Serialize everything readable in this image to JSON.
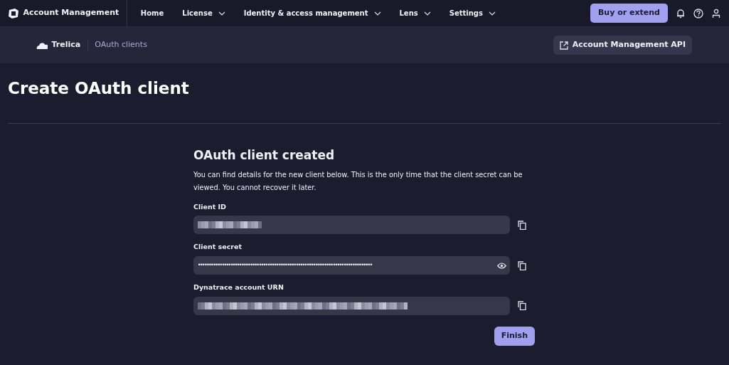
{
  "app": {
    "title": "Account Management"
  },
  "nav": [
    {
      "label": "Home",
      "dropdown": false
    },
    {
      "label": "License",
      "dropdown": true
    },
    {
      "label": "Identity & access management",
      "dropdown": true
    },
    {
      "label": "Lens",
      "dropdown": true
    },
    {
      "label": "Settings",
      "dropdown": true
    }
  ],
  "header_button": "Buy or extend",
  "breadcrumb": [
    {
      "label": "Trelica",
      "icon": true
    },
    {
      "label": "OAuth clients",
      "icon": false
    }
  ],
  "api_link": "Account Management API",
  "page_title": "Create OAuth client",
  "panel": {
    "title": "OAuth client created",
    "description": "You can find details for the new client below. This is the only time that the client secret can be viewed. You cannot recover it later.",
    "fields": [
      {
        "label": "Client ID",
        "kind": "redacted",
        "reveal": false
      },
      {
        "label": "Client secret",
        "kind": "masked",
        "value": "••••••••••••••••••••••••••••••••••••••••••••••••••••••••••••••••••••••••••••••••",
        "reveal": true
      },
      {
        "label": "Dynatrace account URN",
        "kind": "redacted",
        "reveal": false
      }
    ],
    "button": "Finish"
  }
}
